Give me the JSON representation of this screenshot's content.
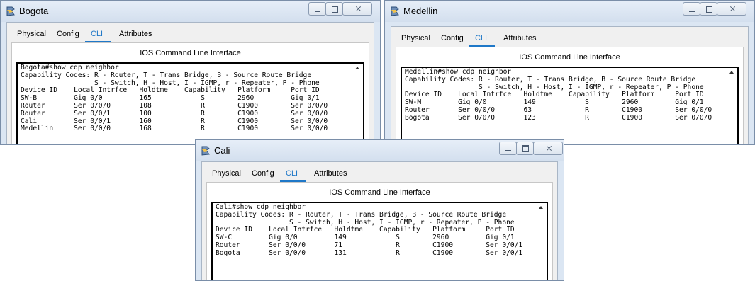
{
  "windows": [
    {
      "title": "Bogota",
      "tabs": [
        "Physical",
        "Config",
        "CLI",
        "Attributes"
      ],
      "active_tab": "CLI",
      "cli_title": "IOS Command Line Interface",
      "console_lines": [
        "Bogota#show cdp neighbor",
        "Capability Codes: R - Router, T - Trans Bridge, B - Source Route Bridge",
        "                  S - Switch, H - Host, I - IGMP, r - Repeater, P - Phone",
        "Device ID    Local Intrfce   Holdtme    Capability   Platform     Port ID",
        "SW-B         Gig 0/0         165            S        2960         Gig 0/1",
        "Router       Ser 0/0/0       108            R        C1900        Ser 0/0/0",
        "Router       Ser 0/0/1       100            R        C1900        Ser 0/0/0",
        "Cali         Ser 0/0/1       160            R        C1900        Ser 0/0/0",
        "Medellin     Ser 0/0/0       168            R        C1900        Ser 0/0/0"
      ]
    },
    {
      "title": "Medellin",
      "tabs": [
        "Physical",
        "Config",
        "CLI",
        "Attributes"
      ],
      "active_tab": "CLI",
      "cli_title": "IOS Command Line Interface",
      "console_lines": [
        "Medellin#show cdp neighbor",
        "Capability Codes: R - Router, T - Trans Bridge, B - Source Route Bridge",
        "                  S - Switch, H - Host, I - IGMP, r - Repeater, P - Phone",
        "Device ID    Local Intrfce   Holdtme    Capability   Platform     Port ID",
        "SW-M         Gig 0/0         149            S        2960         Gig 0/1",
        "Router       Ser 0/0/0       63             R        C1900        Ser 0/0/0",
        "Bogota       Ser 0/0/0       123            R        C1900        Ser 0/0/0"
      ]
    },
    {
      "title": "Cali",
      "tabs": [
        "Physical",
        "Config",
        "CLI",
        "Attributes"
      ],
      "active_tab": "CLI",
      "cli_title": "IOS Command Line Interface",
      "console_lines": [
        "Cali#show cdp neighbor",
        "Capability Codes: R - Router, T - Trans Bridge, B - Source Route Bridge",
        "                  S - Switch, H - Host, I - IGMP, r - Repeater, P - Phone",
        "Device ID    Local Intrfce   Holdtme    Capability   Platform     Port ID",
        "SW-C         Gig 0/0         149            S        2960         Gig 0/1",
        "Router       Ser 0/0/0       71             R        C1900        Ser 0/0/1",
        "Bogota       Ser 0/0/0       131            R        C1900        Ser 0/0/1"
      ]
    }
  ],
  "icons": {
    "window_icon": "packet-tracer-router-icon"
  },
  "colors": {
    "accent": "#1f78c8",
    "titlebar": "#dbe6f3"
  }
}
